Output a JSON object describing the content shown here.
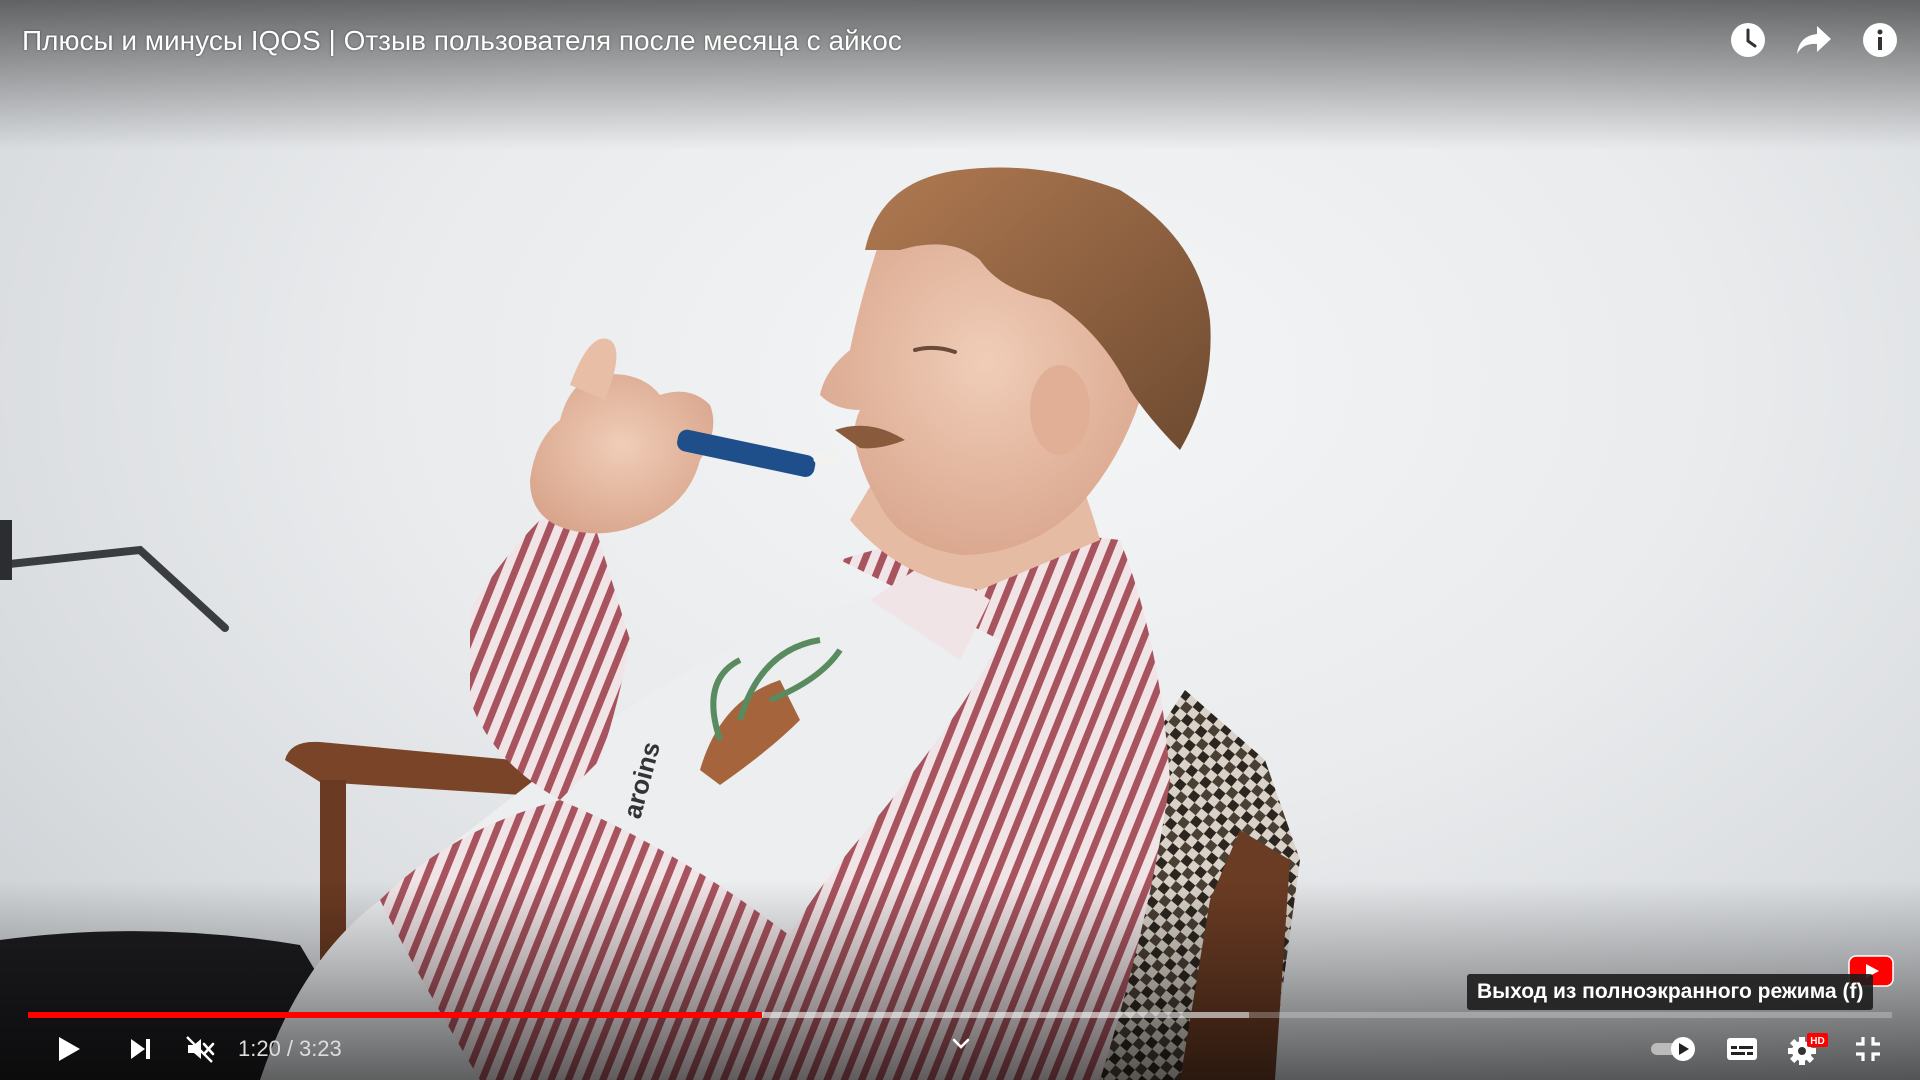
{
  "video": {
    "title": "Плюсы и минусы IQOS | Отзыв пользователя после месяца с айкос",
    "shirt_print": "aroins"
  },
  "top_actions": [
    {
      "name": "watch-later-button",
      "icon": "clock-icon"
    },
    {
      "name": "share-button",
      "icon": "share-arrow-icon"
    },
    {
      "name": "info-button",
      "icon": "info-icon"
    }
  ],
  "tooltip": {
    "text": "Выход из полноэкранного режима (f)"
  },
  "progress": {
    "played_fraction": 0.394,
    "buffered_fraction": 0.655
  },
  "time": {
    "current": "1:20",
    "separator": "/",
    "duration": "3:23"
  },
  "controls": {
    "left": [
      "play-icon",
      "next-icon",
      "volume-muted-icon"
    ],
    "center": [
      "chevron-down-icon"
    ],
    "right": [
      "autoplay-toggle",
      "subtitles-icon",
      "settings-icon",
      "exit-fullscreen-icon"
    ],
    "hd_badge": "HD",
    "autoplay_on": true
  },
  "colors": {
    "progress_played": "#ff0000",
    "hd_badge": "#ff0000",
    "text": "#ffffff"
  }
}
